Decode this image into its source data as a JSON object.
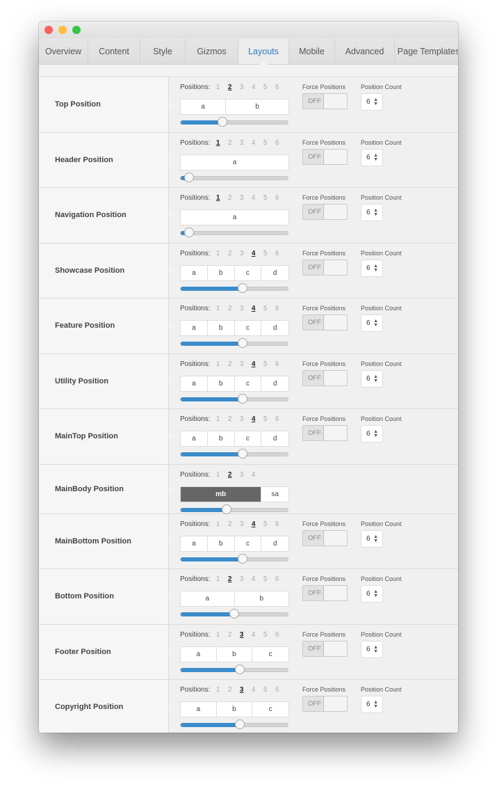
{
  "window": {
    "controls": [
      {
        "name": "close",
        "color": "#fc605c"
      },
      {
        "name": "minimize",
        "color": "#fdbc40"
      },
      {
        "name": "zoom",
        "color": "#34c84a"
      }
    ]
  },
  "tabs": [
    {
      "label": "Overview",
      "active": false
    },
    {
      "label": "Content",
      "active": false
    },
    {
      "label": "Style",
      "active": false
    },
    {
      "label": "Gizmos",
      "active": false
    },
    {
      "label": "Layouts",
      "active": true
    },
    {
      "label": "Mobile",
      "active": false
    },
    {
      "label": "Advanced",
      "active": false
    },
    {
      "label": "Page Templates",
      "active": false
    }
  ],
  "labels": {
    "positions": "Positions:",
    "force": "Force Positions",
    "count": "Position Count",
    "off": "OFF"
  },
  "accent": "#3b8ccb",
  "rows": [
    {
      "title": "Top Position",
      "options": [
        "1",
        "2",
        "3",
        "4",
        "5",
        "6"
      ],
      "selected": "2",
      "columns": [
        {
          "label": "a",
          "size": 42
        },
        {
          "label": "b",
          "size": 58
        }
      ],
      "slider": 0.39,
      "force": "OFF",
      "count": "6"
    },
    {
      "title": "Header Position",
      "options": [
        "1",
        "2",
        "3",
        "4",
        "5",
        "6"
      ],
      "selected": "1",
      "columns": [
        {
          "label": "a",
          "size": 100
        }
      ],
      "slider": 0.08,
      "force": "OFF",
      "count": "6"
    },
    {
      "title": "Navigation Position",
      "options": [
        "1",
        "2",
        "3",
        "4",
        "5",
        "6"
      ],
      "selected": "1",
      "columns": [
        {
          "label": "a",
          "size": 100
        }
      ],
      "slider": 0.08,
      "force": "OFF",
      "count": "6"
    },
    {
      "title": "Showcase Position",
      "options": [
        "1",
        "2",
        "3",
        "4",
        "5",
        "6"
      ],
      "selected": "4",
      "columns": [
        {
          "label": "a",
          "size": 25
        },
        {
          "label": "b",
          "size": 25
        },
        {
          "label": "c",
          "size": 25
        },
        {
          "label": "d",
          "size": 25
        }
      ],
      "slider": 0.58,
      "force": "OFF",
      "count": "6"
    },
    {
      "title": "Feature Position",
      "options": [
        "1",
        "2",
        "3",
        "4",
        "5",
        "6"
      ],
      "selected": "4",
      "columns": [
        {
          "label": "a",
          "size": 25
        },
        {
          "label": "b",
          "size": 25
        },
        {
          "label": "c",
          "size": 25
        },
        {
          "label": "d",
          "size": 25
        }
      ],
      "slider": 0.58,
      "force": "OFF",
      "count": "6"
    },
    {
      "title": "Utility Position",
      "options": [
        "1",
        "2",
        "3",
        "4",
        "5",
        "6"
      ],
      "selected": "4",
      "columns": [
        {
          "label": "a",
          "size": 25
        },
        {
          "label": "b",
          "size": 25
        },
        {
          "label": "c",
          "size": 25
        },
        {
          "label": "d",
          "size": 25
        }
      ],
      "slider": 0.58,
      "force": "OFF",
      "count": "6"
    },
    {
      "title": "MainTop Position",
      "options": [
        "1",
        "2",
        "3",
        "4",
        "5",
        "6"
      ],
      "selected": "4",
      "columns": [
        {
          "label": "a",
          "size": 25
        },
        {
          "label": "b",
          "size": 25
        },
        {
          "label": "c",
          "size": 25
        },
        {
          "label": "d",
          "size": 25
        }
      ],
      "slider": 0.58,
      "force": "OFF",
      "count": "6"
    },
    {
      "title": "MainBody Position",
      "options": [
        "1",
        "2",
        "3",
        "4"
      ],
      "selected": "2",
      "columns": [
        {
          "label": "mb",
          "size": 75,
          "dark": true
        },
        {
          "label": "sa",
          "size": 25
        }
      ],
      "slider": 0.43
    },
    {
      "title": "MainBottom Position",
      "options": [
        "1",
        "2",
        "3",
        "4",
        "5",
        "6"
      ],
      "selected": "4",
      "columns": [
        {
          "label": "a",
          "size": 25
        },
        {
          "label": "b",
          "size": 25
        },
        {
          "label": "c",
          "size": 25
        },
        {
          "label": "d",
          "size": 25
        }
      ],
      "slider": 0.58,
      "force": "OFF",
      "count": "6"
    },
    {
      "title": "Bottom Position",
      "options": [
        "1",
        "2",
        "3",
        "4",
        "5",
        "6"
      ],
      "selected": "2",
      "columns": [
        {
          "label": "a",
          "size": 50
        },
        {
          "label": "b",
          "size": 50
        }
      ],
      "slider": 0.5,
      "force": "OFF",
      "count": "6"
    },
    {
      "title": "Footer Position",
      "options": [
        "1",
        "2",
        "3",
        "4",
        "5",
        "6"
      ],
      "selected": "3",
      "columns": [
        {
          "label": "a",
          "size": 33.3
        },
        {
          "label": "b",
          "size": 33.3
        },
        {
          "label": "c",
          "size": 33.4
        }
      ],
      "slider": 0.55,
      "force": "OFF",
      "count": "6"
    },
    {
      "title": "Copyright Position",
      "options": [
        "1",
        "2",
        "3",
        "4",
        "5",
        "6"
      ],
      "selected": "3",
      "columns": [
        {
          "label": "a",
          "size": 33.3
        },
        {
          "label": "b",
          "size": 33.3
        },
        {
          "label": "c",
          "size": 33.4
        }
      ],
      "slider": 0.55,
      "force": "OFF",
      "count": "6"
    }
  ]
}
